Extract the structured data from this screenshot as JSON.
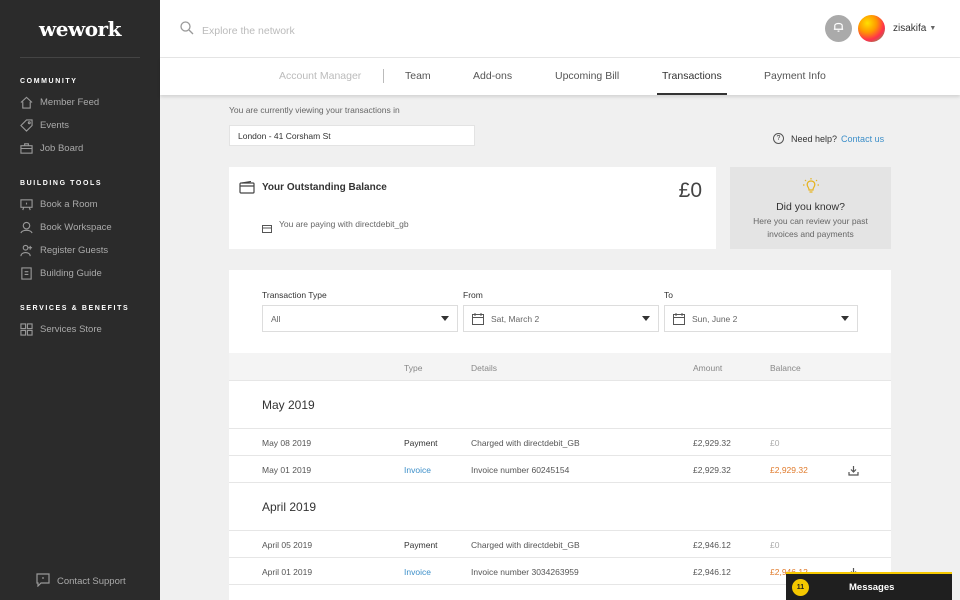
{
  "brand": {
    "logo_text": "wework"
  },
  "sidebar": {
    "sections": [
      {
        "title": "COMMUNITY",
        "items": [
          {
            "label": "Member Feed",
            "icon": "home-icon"
          },
          {
            "label": "Events",
            "icon": "tag-icon"
          },
          {
            "label": "Job Board",
            "icon": "briefcase-icon"
          }
        ]
      },
      {
        "title": "BUILDING TOOLS",
        "items": [
          {
            "label": "Book a Room",
            "icon": "room-icon"
          },
          {
            "label": "Book Workspace",
            "icon": "workspace-icon"
          },
          {
            "label": "Register Guests",
            "icon": "add-user-icon"
          },
          {
            "label": "Building Guide",
            "icon": "guide-icon"
          }
        ]
      },
      {
        "title": "SERVICES & BENEFITS",
        "items": [
          {
            "label": "Services Store",
            "icon": "grid-icon"
          }
        ]
      }
    ],
    "support_label": "Contact Support"
  },
  "topbar": {
    "search_placeholder": "Explore the network",
    "username": "zisakifa"
  },
  "tabs": [
    {
      "label": "Account Manager",
      "state": "disabled"
    },
    {
      "label": "Team",
      "state": "normal"
    },
    {
      "label": "Add-ons",
      "state": "normal"
    },
    {
      "label": "Upcoming Bill",
      "state": "normal"
    },
    {
      "label": "Transactions",
      "state": "active"
    },
    {
      "label": "Payment Info",
      "state": "normal"
    }
  ],
  "content": {
    "viewing_text": "You are currently viewing your transactions in",
    "location": "London - 41 Corsham St",
    "help_text": "Need help?",
    "help_link": "Contact us",
    "balance": {
      "title": "Your Outstanding Balance",
      "amount": "£0",
      "paying_text": "You are paying with directdebit_gb"
    },
    "tip": {
      "title": "Did you know?",
      "body": "Here you can review your past invoices and payments"
    },
    "filters": {
      "type_label": "Transaction Type",
      "type_value": "All",
      "from_label": "From",
      "from_value": "Sat, March 2",
      "to_label": "To",
      "to_value": "Sun, June 2"
    },
    "table": {
      "headers": {
        "type": "Type",
        "details": "Details",
        "amount": "Amount",
        "balance": "Balance"
      },
      "groups": [
        {
          "month": "May 2019",
          "rows": [
            {
              "date": "May 08 2019",
              "type": "Payment",
              "details": "Charged with directdebit_GB",
              "amount": "£2,929.32",
              "balance": "£0"
            },
            {
              "date": "May 01 2019",
              "type": "Invoice",
              "details": "Invoice number 60245154",
              "amount": "£2,929.32",
              "balance": "£2,929.32"
            }
          ]
        },
        {
          "month": "April 2019",
          "rows": [
            {
              "date": "April 05 2019",
              "type": "Payment",
              "details": "Charged with directdebit_GB",
              "amount": "£2,946.12",
              "balance": "£0"
            },
            {
              "date": "April 01 2019",
              "type": "Invoice",
              "details": "Invoice number 3034263959",
              "amount": "£2,946.12",
              "balance": "£2,946.12"
            }
          ]
        }
      ]
    }
  },
  "messages": {
    "label": "Messages",
    "count": "11"
  },
  "colors": {
    "accent": "#3d8fc9",
    "due": "#e07b2c",
    "sidebar": "#2b2b2b",
    "badge": "#f5c800"
  }
}
